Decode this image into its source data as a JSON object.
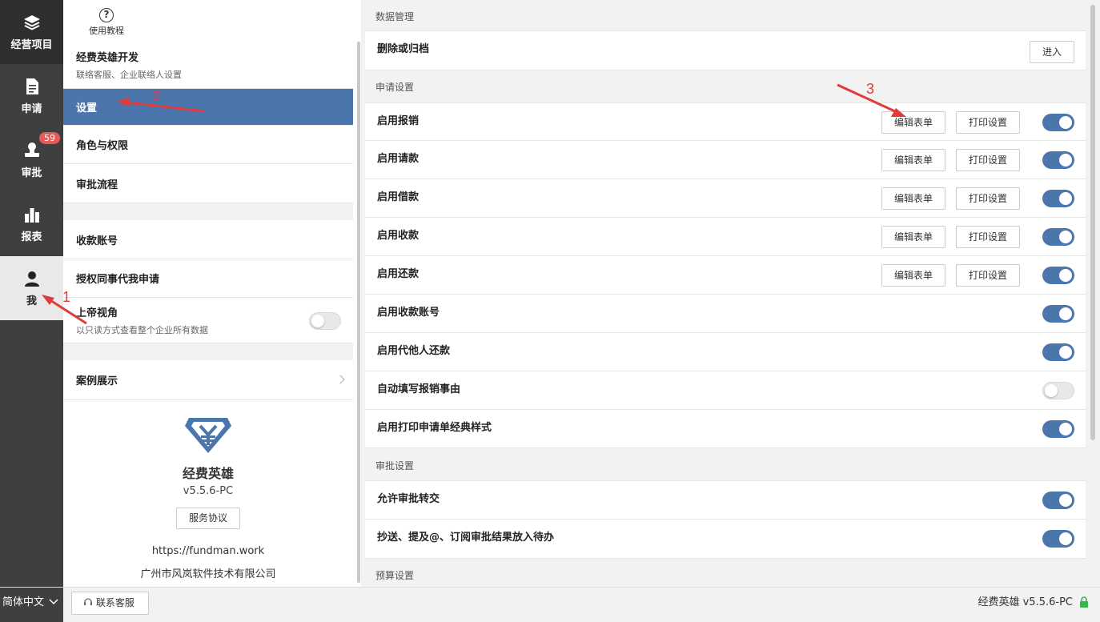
{
  "nav": {
    "items": [
      {
        "label": "经营项目",
        "icon": "layers-icon"
      },
      {
        "label": "申请",
        "icon": "document-icon"
      },
      {
        "label": "审批",
        "icon": "stamp-icon",
        "badge": "59"
      },
      {
        "label": "报表",
        "icon": "bar-chart-icon"
      },
      {
        "label": "我",
        "icon": "user-icon"
      }
    ]
  },
  "middle": {
    "help_label": "使用教程",
    "dev": {
      "title": "经费英雄开发",
      "subtitle": "联络客服、企业联络人设置"
    },
    "settings": "设置",
    "roles": "角色与权限",
    "flow": "审批流程",
    "accounts": "收款账号",
    "delegate": "授权同事代我申请",
    "godview": {
      "title": "上帝视角",
      "subtitle": "以只读方式查看整个企业所有数据",
      "enabled": false
    },
    "cases": "案例展示",
    "brand": {
      "name": "经费英雄",
      "version": "v5.5.6-PC",
      "service_button": "服务协议",
      "url": "https://fundman.work",
      "company": "广州市风岚软件技术有限公司"
    }
  },
  "right": {
    "sections": {
      "data_mgmt": "数据管理",
      "apply_settings": "申请设置",
      "approval_settings": "审批设置",
      "budget_settings": "预算设置"
    },
    "archive": {
      "label": "删除或归档",
      "button": "进入"
    },
    "buttons": {
      "edit": "编辑表单",
      "print": "打印设置"
    },
    "apply_rows": [
      {
        "label": "启用报销",
        "enabled": true
      },
      {
        "label": "启用请款",
        "enabled": true
      },
      {
        "label": "启用借款",
        "enabled": true
      },
      {
        "label": "启用收款",
        "enabled": true
      },
      {
        "label": "启用还款",
        "enabled": true
      },
      {
        "label": "启用收款账号",
        "enabled": true
      },
      {
        "label": "启用代他人还款",
        "enabled": true
      },
      {
        "label": "自动填写报销事由",
        "enabled": false
      },
      {
        "label": "启用打印申请单经典样式",
        "enabled": true
      }
    ],
    "approval_rows": [
      {
        "label": "允许审批转交",
        "enabled": true
      },
      {
        "label": "抄送、提及@、订阅审批结果放入待办",
        "enabled": true
      }
    ]
  },
  "bottom": {
    "language": "简体中文",
    "contact": "联系客服",
    "version_status": "经费英雄 v5.5.6-PC"
  },
  "annotations": {
    "n1": "1",
    "n2": "2",
    "n3": "3",
    "color": "#e23b3b"
  },
  "colors": {
    "accent": "#4a76ab",
    "nav_bg": "#3f3f3f",
    "badge": "#e65a5a"
  }
}
